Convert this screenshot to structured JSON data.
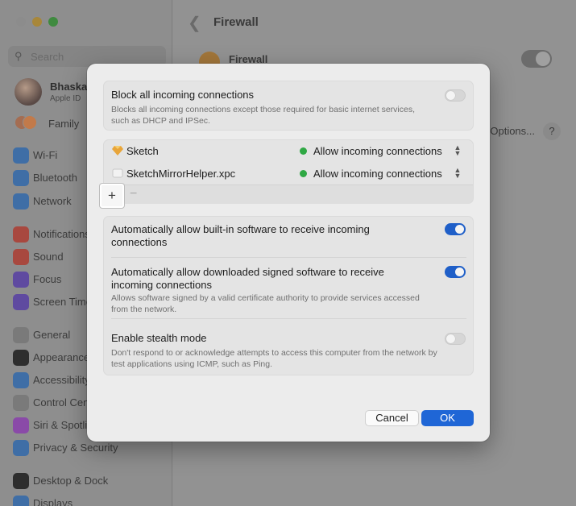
{
  "sidebar": {
    "search_placeholder": "Search",
    "user": {
      "name": "Bhaskar",
      "subtitle": "Apple ID"
    },
    "family_label": "Family",
    "items": [
      {
        "label": "Wi-Fi",
        "icon": "wifi-icon",
        "color": "#3f6ea6"
      },
      {
        "label": "Bluetooth",
        "icon": "bluetooth-icon",
        "color": "#3f6ea6"
      },
      {
        "label": "Network",
        "icon": "network-icon",
        "color": "#3f6ea6"
      },
      {
        "label": "Notifications",
        "icon": "notifications-icon",
        "color": "#a8483f"
      },
      {
        "label": "Sound",
        "icon": "sound-icon",
        "color": "#a8483f"
      },
      {
        "label": "Focus",
        "icon": "focus-icon",
        "color": "#5f4aa0"
      },
      {
        "label": "Screen Time",
        "icon": "screen-time-icon",
        "color": "#5f4aa0"
      },
      {
        "label": "General",
        "icon": "gear-icon",
        "color": "#7a7a7a"
      },
      {
        "label": "Appearance",
        "icon": "appearance-icon",
        "color": "#2e2e2e"
      },
      {
        "label": "Accessibility",
        "icon": "accessibility-icon",
        "color": "#3f6ea6"
      },
      {
        "label": "Control Centre",
        "icon": "control-centre-icon",
        "color": "#7a7a7a"
      },
      {
        "label": "Siri & Spotlight",
        "icon": "siri-icon",
        "color": "#8a4aa8"
      },
      {
        "label": "Privacy & Security",
        "icon": "privacy-hand-icon",
        "color": "#3f6ea6"
      },
      {
        "label": "Desktop & Dock",
        "icon": "desktop-dock-icon",
        "color": "#2e2e2e"
      },
      {
        "label": "Displays",
        "icon": "displays-icon",
        "color": "#3f6ea6"
      }
    ]
  },
  "main": {
    "title": "Firewall",
    "firewall_label": "Firewall",
    "options_label": "Options...",
    "help_label": "?"
  },
  "dialog": {
    "block_all": {
      "title": "Block all incoming connections",
      "description": "Blocks all incoming connections except those required for basic internet services, such as DHCP and IPSec.",
      "enabled": false
    },
    "apps": [
      {
        "name": "Sketch",
        "status": "Allow incoming connections",
        "status_color": "#2fa844"
      },
      {
        "name": "SketchMirrorHelper.xpc",
        "status": "Allow incoming connections",
        "status_color": "#2fa844"
      }
    ],
    "add_label": "+",
    "remove_label": "−",
    "auto_builtin": {
      "title": "Automatically allow built-in software to receive incoming connections",
      "enabled": true
    },
    "auto_signed": {
      "title": "Automatically allow downloaded signed software to receive incoming connections",
      "description": "Allows software signed by a valid certificate authority to provide services accessed from the network.",
      "enabled": true
    },
    "stealth": {
      "title": "Enable stealth mode",
      "description": "Don't respond to or acknowledge attempts to access this computer from the network by test applications using ICMP, such as Ping.",
      "enabled": false
    },
    "cancel_label": "Cancel",
    "ok_label": "OK",
    "accent_color": "#1f66d6"
  }
}
